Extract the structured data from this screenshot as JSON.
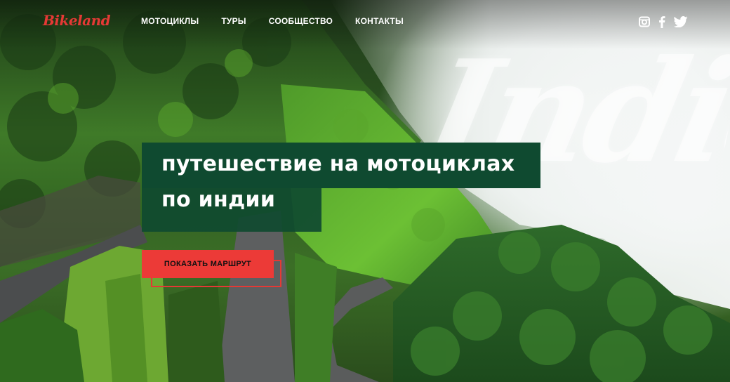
{
  "brand": {
    "logo_text": "Bikeland",
    "accent_color": "#ec3a37",
    "headline_bg": "#0f4a30"
  },
  "nav": {
    "items": [
      {
        "label": "МОТОЦИКЛЫ"
      },
      {
        "label": "ТУРЫ"
      },
      {
        "label": "СООБЩЕСТВО"
      },
      {
        "label": "КОНТАКТЫ"
      }
    ]
  },
  "social": {
    "icons": [
      "instagram-icon",
      "facebook-icon",
      "twitter-icon"
    ]
  },
  "hero": {
    "headline_line1": "путешествие на мотоциклах",
    "headline_line2": "по индии",
    "watermark_text": "India",
    "cta_label": "ПОКАЗАТЬ МАРШРУТ"
  }
}
